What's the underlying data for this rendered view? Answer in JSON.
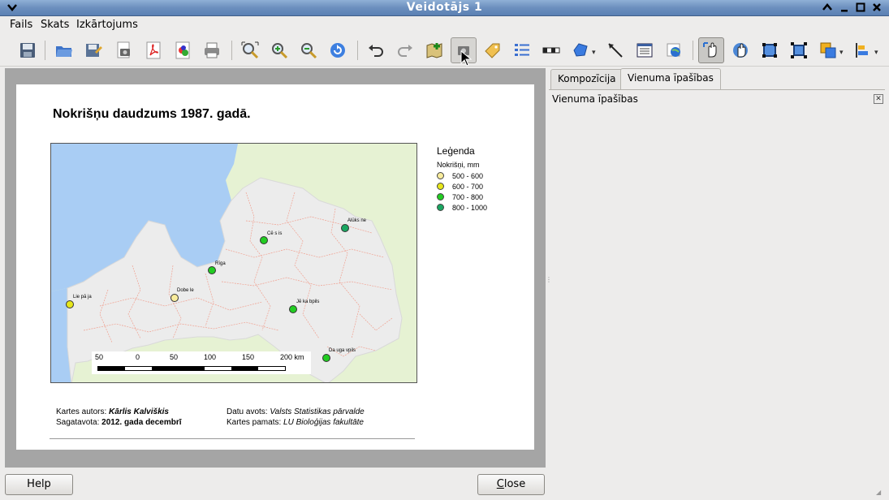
{
  "window": {
    "title": "Veidotājs 1",
    "icons": [
      "menu-chevron-icon",
      "shade-up-icon",
      "minimize-icon",
      "maximize-icon",
      "close-icon"
    ]
  },
  "menubar": {
    "items": [
      "Fails",
      "Skats",
      "Izkārtojums"
    ]
  },
  "toolbar": {
    "tools": [
      "save-icon",
      "open-icon",
      "save-as-template-icon",
      "export-image-icon",
      "export-pdf-icon",
      "export-svg-icon",
      "print-icon",
      "zoom-full-icon",
      "zoom-in-icon",
      "zoom-out-icon",
      "refresh-icon",
      "undo-icon",
      "redo-icon",
      "add-map-icon",
      "add-image-icon",
      "add-label-icon",
      "add-legend-icon",
      "add-scalebar-icon",
      "add-shape-icon",
      "add-arrow-icon",
      "add-table-icon",
      "add-html-icon",
      "select-move-icon",
      "move-content-icon",
      "group-icon",
      "ungroup-icon",
      "raise-icon",
      "align-icon"
    ]
  },
  "composer": {
    "map_title": "Nokrišņu daudzums 1987. gadā.",
    "legend": {
      "title": "Leģenda",
      "subtitle": "Nokrišņi, mm",
      "items": [
        {
          "label": "500 - 600",
          "color": "#f8ec9c"
        },
        {
          "label": "600 - 700",
          "color": "#e6e61a"
        },
        {
          "label": "700 - 800",
          "color": "#22cc22"
        },
        {
          "label": "800 - 1000",
          "color": "#1aa661"
        }
      ]
    },
    "stations": [
      {
        "name": "Alūks ne",
        "color": "#1aa661"
      },
      {
        "name": "Cē s is",
        "color": "#22cc22"
      },
      {
        "name": "Rīga",
        "color": "#22cc22"
      },
      {
        "name": "Dobe le",
        "color": "#f8ec9c"
      },
      {
        "name": "Lie pā ja",
        "color": "#e6e61a"
      },
      {
        "name": "Jē ka bpils",
        "color": "#22cc22"
      },
      {
        "name": "Da uga vpils",
        "color": "#22cc22"
      }
    ],
    "scalebar": {
      "labels": [
        "50",
        "0",
        "50",
        "100",
        "150",
        "200 km"
      ]
    },
    "credits": {
      "author_label": "Kartes autors:",
      "author": "Kārlis Kalviškis",
      "prepared_label": "Sagatavota:",
      "prepared": "2012. gada decembrī",
      "source_label": "Datu avots:",
      "source": "Valsts Statistikas pārvalde",
      "base_label": "Kartes pamats:",
      "base": "LU Bioloģijas fakultāte"
    }
  },
  "dock": {
    "tabs": [
      "Kompozīcija",
      "Vienuma īpašības"
    ],
    "selected_tab": "Vienuma īpašības",
    "panel_title": "Vienuma īpašības"
  },
  "buttons": {
    "help": "Help",
    "close_first": "C",
    "close_rest": "lose"
  }
}
